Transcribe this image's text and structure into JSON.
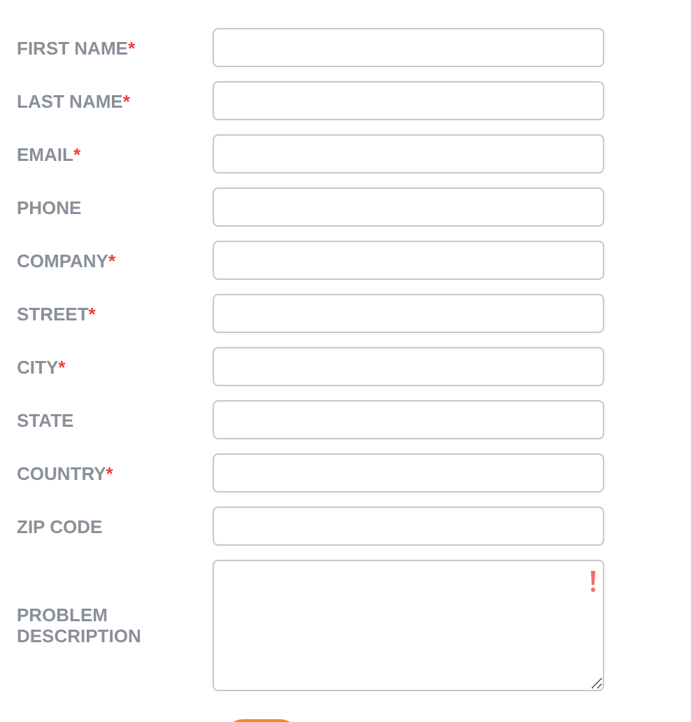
{
  "fields": [
    {
      "label": "FIRST NAME",
      "marker": "*",
      "kind": "input"
    },
    {
      "label": "LAST NAME",
      "marker": "*",
      "kind": "input"
    },
    {
      "label": "EMAIL",
      "marker": "*",
      "kind": "input"
    },
    {
      "label": "PHONE",
      "kind": "input"
    },
    {
      "label": "COMPANY",
      "marker": "*",
      "kind": "input"
    },
    {
      "label": "STREET",
      "marker": "*",
      "kind": "input"
    },
    {
      "label": "CITY",
      "marker": "*",
      "kind": "input"
    },
    {
      "label": "STATE",
      "kind": "input"
    },
    {
      "label": "COUNTRY",
      "marker": "*",
      "kind": "input"
    },
    {
      "label": "ZIP CODE",
      "kind": "input"
    },
    {
      "label": "PROBLEM DESCRIPTION",
      "kind": "textarea",
      "invalid": true
    }
  ]
}
